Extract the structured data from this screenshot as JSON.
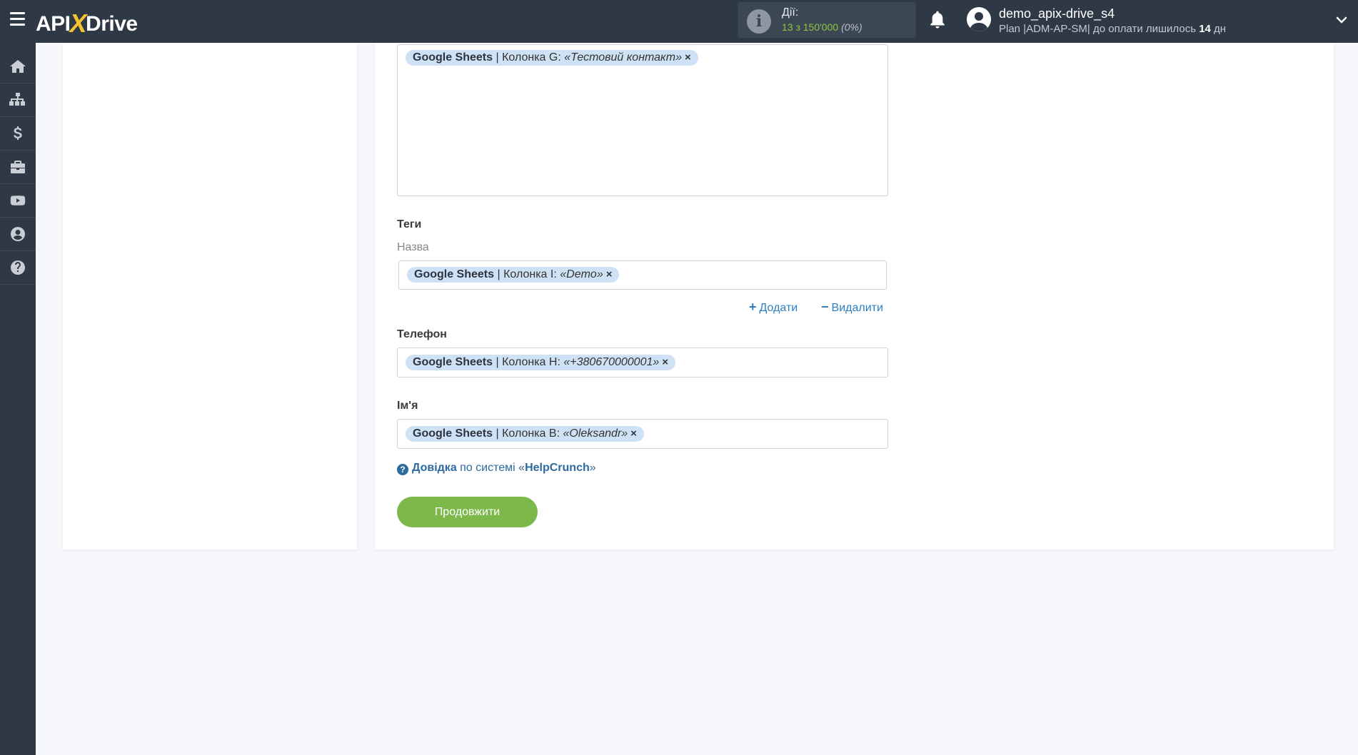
{
  "header": {
    "logo": {
      "api": "API",
      "x": "X",
      "drive": "Drive"
    },
    "actions": {
      "label": "Дії:",
      "count": "13 з 150'000",
      "percent": "(0%)"
    },
    "user": {
      "name": "demo_apix-drive_s4",
      "plan_prefix": "Plan |ADM-AP-SM| до оплати лишилось ",
      "days": "14",
      "days_suffix": " дн"
    }
  },
  "sidebar": {
    "items": [
      {
        "name": "home",
        "icon": "home-icon"
      },
      {
        "name": "connections",
        "icon": "sitemap-icon"
      },
      {
        "name": "billing",
        "icon": "dollar-icon"
      },
      {
        "name": "tools",
        "icon": "briefcase-icon"
      },
      {
        "name": "video",
        "icon": "youtube-icon"
      },
      {
        "name": "account",
        "icon": "user-circle-icon"
      },
      {
        "name": "help",
        "icon": "question-icon"
      }
    ]
  },
  "form": {
    "top_field": {
      "source": "Google Sheets",
      "column": " | Колонка G: ",
      "value": "«Тестовий контакт»",
      "remove": "×"
    },
    "tags": {
      "label": "Теги",
      "sublabel": "Назва",
      "tag": {
        "source": "Google Sheets",
        "column": " | Колонка I: ",
        "value": "«Demo»",
        "remove": "×"
      },
      "add": "Додати",
      "remove": "Видалити"
    },
    "phone": {
      "label": "Телефон",
      "tag": {
        "source": "Google Sheets",
        "column": " | Колонка H: ",
        "value": "«+380670000001»",
        "remove": "×"
      }
    },
    "name": {
      "label": "Ім'я",
      "tag": {
        "source": "Google Sheets",
        "column": " | Колонка B: ",
        "value": "«Oleksandr»",
        "remove": "×"
      }
    },
    "help": {
      "link": "Довідка",
      "middle": " по системі «",
      "system": "HelpCrunch",
      "end": "»"
    },
    "continue": "Продовжити"
  },
  "colors": {
    "topbar": "#2f3945",
    "accent_yellow": "#f4c430",
    "count_green": "#8dc63f",
    "tag_bg": "#cfe2f5",
    "link_blue": "#2d7ec0",
    "button_green": "#7cb94a"
  }
}
